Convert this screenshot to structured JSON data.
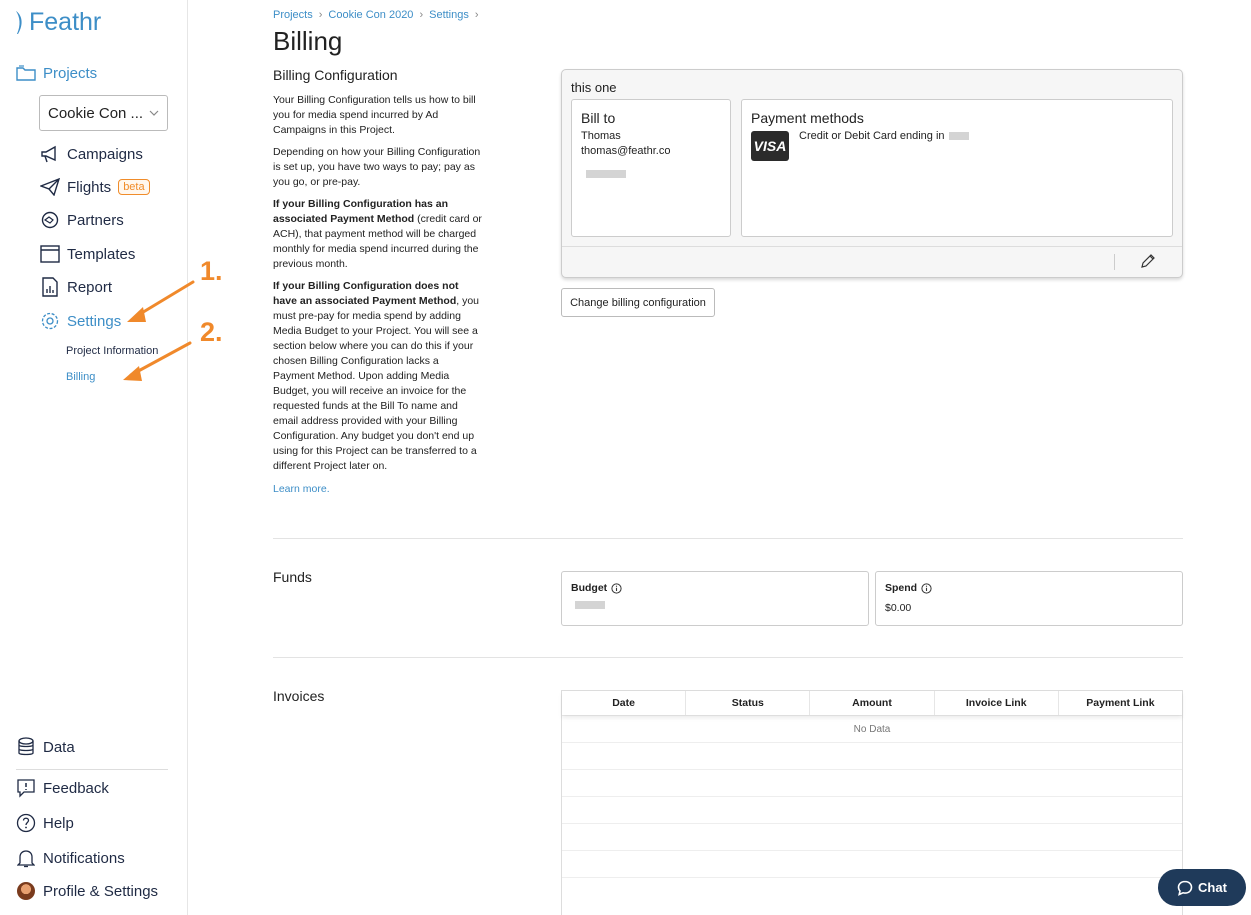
{
  "brand": {
    "name": "Feathr",
    "color": "#3d8ec7"
  },
  "sidebar": {
    "projects_label": "Projects",
    "project_select": "Cookie Con ...",
    "items": [
      {
        "label": "Campaigns",
        "icon": "megaphone-icon"
      },
      {
        "label": "Flights",
        "icon": "paper-plane-icon",
        "badge": "beta"
      },
      {
        "label": "Partners",
        "icon": "handshake-icon"
      },
      {
        "label": "Templates",
        "icon": "template-icon"
      },
      {
        "label": "Report",
        "icon": "report-icon"
      },
      {
        "label": "Settings",
        "icon": "gear-icon"
      }
    ],
    "settings_sub": [
      {
        "label": "Project Information"
      },
      {
        "label": "Billing"
      }
    ],
    "bottom": [
      {
        "label": "Data",
        "icon": "database-icon"
      },
      {
        "label": "Feedback",
        "icon": "feedback-icon"
      },
      {
        "label": "Help",
        "icon": "help-icon"
      },
      {
        "label": "Notifications",
        "icon": "bell-icon"
      },
      {
        "label": "Profile & Settings",
        "icon": "avatar"
      }
    ]
  },
  "breadcrumb": [
    "Projects",
    "Cookie Con 2020",
    "Settings"
  ],
  "page_title": "Billing",
  "billing_config": {
    "title": "Billing Configuration",
    "p1": "Your Billing Configuration tells us how to bill you for media spend incurred by Ad Campaigns in this Project.",
    "p2": "Depending on how your Billing Configuration is set up, you have two ways to pay; pay as you go, or pre-pay.",
    "p3_bold": "If your Billing Configuration has an associated Payment Method",
    "p3_rest": " (credit card or ACH), that payment method will be charged monthly for media spend incurred during the previous month.",
    "p4_bold": "If your Billing Configuration does not have an associated Payment Method",
    "p4_rest": ", you must pre-pay for media spend by adding Media Budget to your Project. You will see a section below where you can do this if your chosen Billing Configuration lacks a Payment Method. Upon adding Media Budget, you will receive an invoice for the requested funds at the Bill To name and email address provided with your Billing Configuration. Any budget you don't end up using for this Project can be transferred to a different Project later on.",
    "learn_more": "Learn more.",
    "config_name": "this one",
    "bill_to_title": "Bill to",
    "bill_to_name": "Thomas",
    "bill_to_email": "thomas@feathr.co",
    "payment_title": "Payment methods",
    "card_brand": "VISA",
    "card_text": "Credit or Debit Card ending in",
    "change_button": "Change billing configuration"
  },
  "funds": {
    "title": "Funds",
    "budget_label": "Budget",
    "spend_label": "Spend",
    "spend_value": "$0.00"
  },
  "invoices": {
    "title": "Invoices",
    "columns": [
      "Date",
      "Status",
      "Amount",
      "Invoice Link",
      "Payment Link"
    ],
    "empty": "No Data"
  },
  "chat_label": "Chat",
  "annotations": [
    "1.",
    "2."
  ]
}
